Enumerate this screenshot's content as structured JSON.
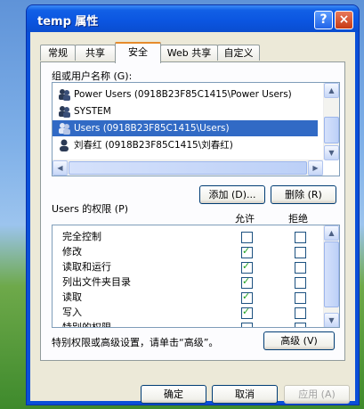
{
  "window": {
    "title": "temp 属性",
    "help_glyph": "?",
    "close_glyph": "×"
  },
  "tabs": [
    "常规",
    "共享",
    "安全",
    "Web 共享",
    "自定义"
  ],
  "active_tab": "安全",
  "users_section": {
    "label": "组或用户名称 (G):",
    "items": [
      {
        "name": "Power Users (0918B23F85C1415\\Power Users)",
        "selected": false
      },
      {
        "name": "SYSTEM",
        "selected": false
      },
      {
        "name": "Users (0918B23F85C1415\\Users)",
        "selected": true
      },
      {
        "name": "刘春红 (0918B23F85C1415\\刘春红)",
        "selected": false
      }
    ],
    "add_button": "添加 (D)...",
    "remove_button": "删除 (R)"
  },
  "permissions": {
    "label": "Users 的权限 (P)",
    "allow_header": "允许",
    "deny_header": "拒绝",
    "rows": [
      {
        "name": "完全控制",
        "allow": false,
        "deny": false
      },
      {
        "name": "修改",
        "allow": true,
        "deny": false
      },
      {
        "name": "读取和运行",
        "allow": true,
        "deny": false
      },
      {
        "name": "列出文件夹目录",
        "allow": true,
        "deny": false
      },
      {
        "name": "读取",
        "allow": true,
        "deny": false
      },
      {
        "name": "写入",
        "allow": true,
        "deny": false
      },
      {
        "name": "特别的权限",
        "allow": false,
        "deny": false
      }
    ],
    "check_glyph": "✓"
  },
  "advanced_hint": "特别权限或高级设置，请单击“高级”。",
  "advanced_button": "高级 (V)",
  "footer": {
    "ok": "确定",
    "cancel": "取消",
    "apply": "应用 (A)"
  },
  "scroll_glyphs": {
    "up": "▲",
    "down": "▼",
    "left": "◀",
    "right": "▶"
  }
}
